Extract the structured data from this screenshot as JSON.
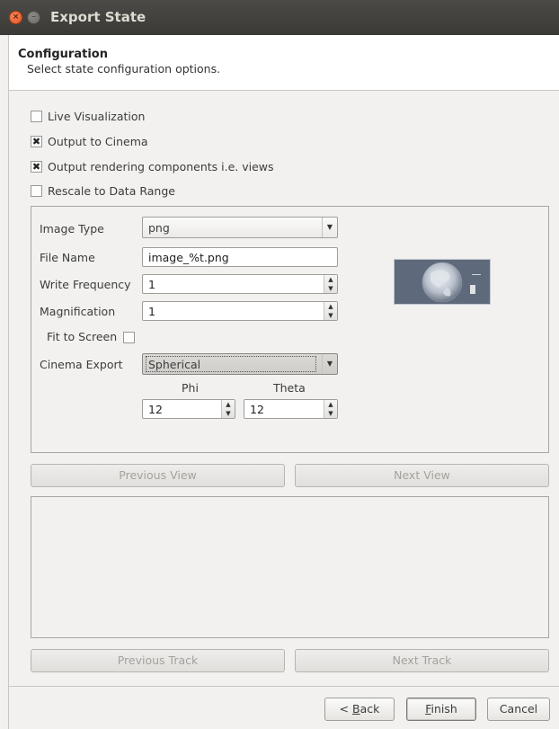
{
  "window": {
    "title": "Export State"
  },
  "header": {
    "title": "Configuration",
    "subtitle": "Select state configuration options."
  },
  "options": {
    "live_visualization": {
      "label": "Live Visualization",
      "checked": false
    },
    "output_to_cinema": {
      "label": "Output to Cinema",
      "checked": true
    },
    "output_rendering_components": {
      "label": "Output rendering components i.e. views",
      "checked": true
    },
    "rescale_to_data_range": {
      "label": "Rescale to Data Range",
      "checked": false
    }
  },
  "view_settings": {
    "image_type": {
      "label": "Image Type",
      "value": "png"
    },
    "file_name": {
      "label": "File Name",
      "value": "image_%t.png"
    },
    "write_frequency": {
      "label": "Write Frequency",
      "value": "1"
    },
    "magnification": {
      "label": "Magnification",
      "value": "1"
    },
    "fit_to_screen": {
      "label": "Fit to Screen",
      "checked": false
    },
    "cinema_export": {
      "label": "Cinema Export",
      "value": "Spherical"
    },
    "phi": {
      "label": "Phi",
      "value": "12"
    },
    "theta": {
      "label": "Theta",
      "value": "12"
    }
  },
  "view_nav": {
    "previous": "Previous View",
    "next": "Next View"
  },
  "track_nav": {
    "previous": "Previous Track",
    "next": "Next Track"
  },
  "footer": {
    "back_mnemonic": "B",
    "back_rest": "ack",
    "back_prefix": "< ",
    "finish_mnemonic": "F",
    "finish_rest": "inish",
    "cancel": "Cancel"
  },
  "icons": {
    "close": "close-icon",
    "minimize": "minimize-icon",
    "checkmark": "✖",
    "dropdown": "▼",
    "spin_up": "▲",
    "spin_down": "▼"
  }
}
